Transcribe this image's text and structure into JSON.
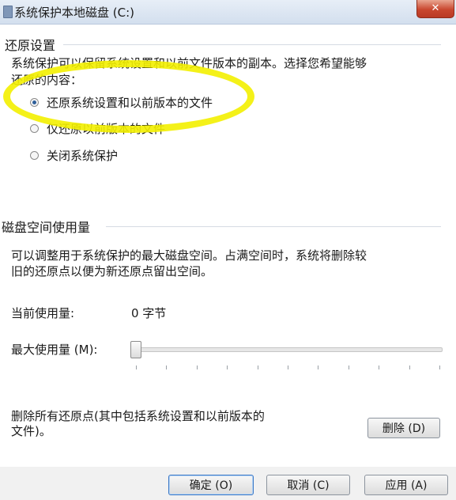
{
  "window": {
    "title": "系统保护本地磁盘 (C:)",
    "close_glyph": "✕"
  },
  "restore": {
    "group_title": "还原设置",
    "description_line1": "系统保护可以保留系统设置和以前文件版本的副本。选择您希望能够",
    "description_line2": "还原的内容：",
    "options": [
      {
        "label": "还原系统设置和以前版本的文件",
        "checked": true
      },
      {
        "label": "仅还原以前版本的文件",
        "checked": false
      },
      {
        "label": "关闭系统保护",
        "checked": false
      }
    ]
  },
  "disk": {
    "group_title": "磁盘空间使用量",
    "description_line1": "可以调整用于系统保护的最大磁盘空间。占满空间时，系统将删除较",
    "description_line2": "旧的还原点以便为新还原点留出空间。",
    "current_label": "当前使用量:",
    "current_value": "0 字节",
    "max_label": "最大使用量 (M):",
    "max_usage_fraction": 0
  },
  "delete": {
    "text_line1": "删除所有还原点(其中包括系统设置和以前版本的",
    "text_line2": "文件)。",
    "button_label": "删除 (D)"
  },
  "footer": {
    "ok_label": "确定 (O)",
    "cancel_label": "取消 (C)",
    "apply_label": "应用 (A)"
  }
}
